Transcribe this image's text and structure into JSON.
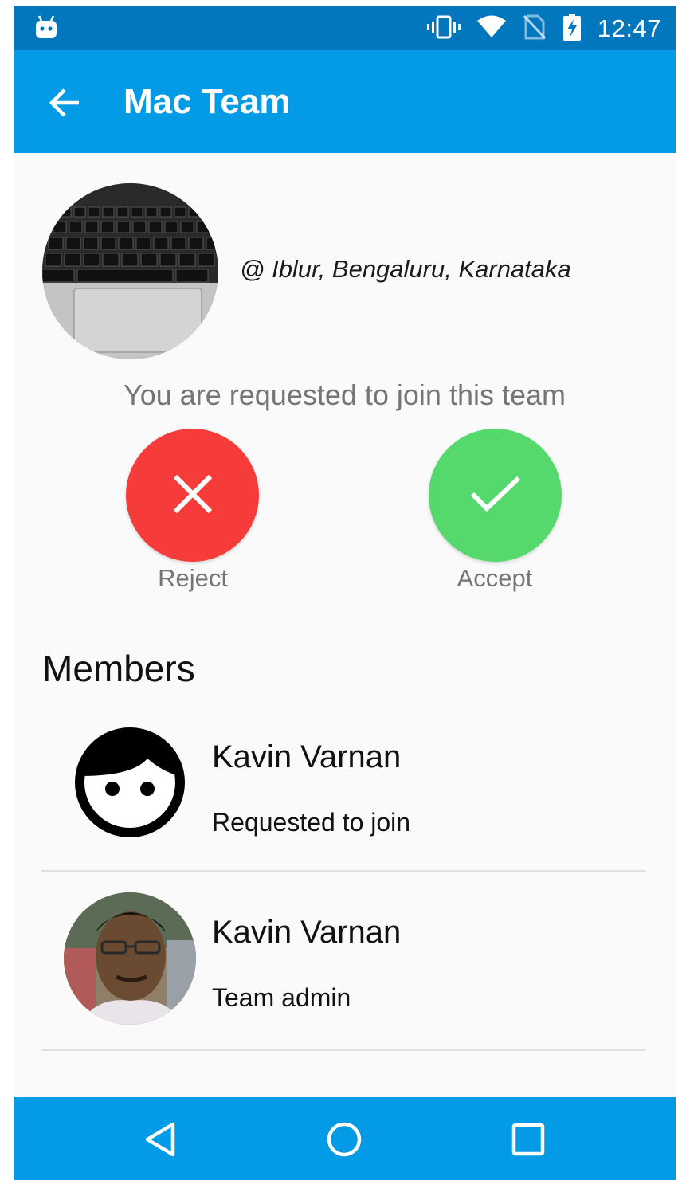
{
  "status_bar": {
    "time": "12:47",
    "icons": [
      "android-debug-icon",
      "vibrate-icon",
      "wifi-icon",
      "no-sim-icon",
      "battery-charging-icon"
    ]
  },
  "app_bar": {
    "title": "Mac Team",
    "back_icon": "arrow-back-icon"
  },
  "team": {
    "location": "@ Iblur, Bengaluru, Karnataka",
    "request_message": "You are requested to join this team",
    "reject_label": "Reject",
    "accept_label": "Accept"
  },
  "members": {
    "heading": "Members",
    "items": [
      {
        "name": "Kavin Varnan",
        "role": "Requested to join",
        "avatar": "face-icon"
      },
      {
        "name": "Kavin Varnan",
        "role": "Team admin",
        "avatar": "profile-photo"
      }
    ]
  },
  "nav_bar": {
    "icons": [
      "back-triangle-icon",
      "home-circle-icon",
      "recents-square-icon"
    ]
  },
  "colors": {
    "status_bar": "#0277bd",
    "app_bar": "#039be5",
    "reject": "#f63b3b",
    "accept": "#55d86c",
    "background": "#fafafa"
  }
}
